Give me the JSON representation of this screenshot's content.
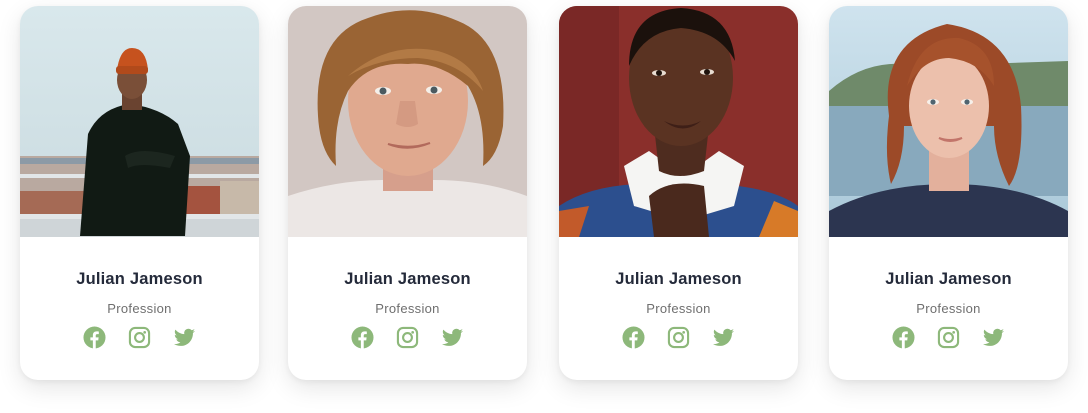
{
  "accent_color": "#8db87a",
  "members": [
    {
      "name": "Julian Jameson",
      "profession": "Profession",
      "photo": "man-orange-beanie-city-view"
    },
    {
      "name": "Julian Jameson",
      "profession": "Profession",
      "photo": "young-man-curly-hair"
    },
    {
      "name": "Julian Jameson",
      "profession": "Profession",
      "photo": "woman-red-background-collar"
    },
    {
      "name": "Julian Jameson",
      "profession": "Profession",
      "photo": "woman-auburn-bob-lake"
    }
  ],
  "social_icons": [
    "facebook-icon",
    "instagram-icon",
    "twitter-icon"
  ]
}
